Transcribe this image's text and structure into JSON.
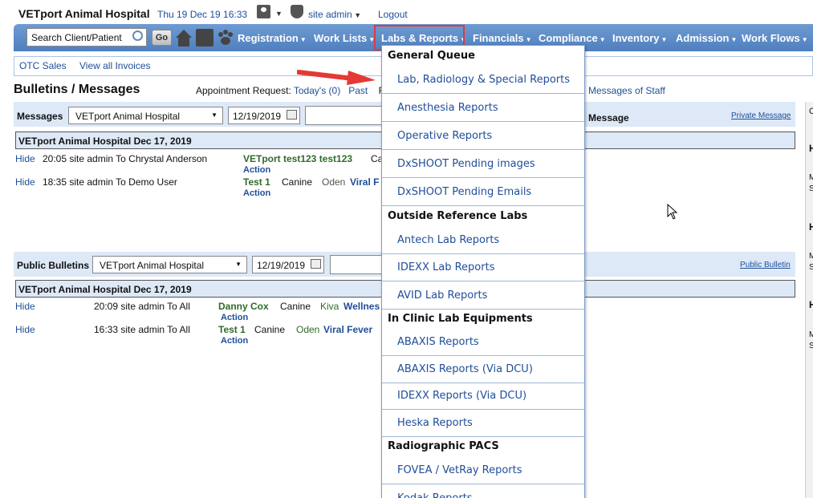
{
  "header": {
    "hospital": "VETport Animal Hospital",
    "datetime": "Thu 19 Dec 19 16:33",
    "user": "site admin",
    "logout": "Logout"
  },
  "nav": {
    "search_placeholder": "Search Client/Patient",
    "go": "Go",
    "items": [
      "Registration",
      "Work Lists",
      "Labs & Reports",
      "Financials",
      "Compliance",
      "Inventory",
      "Admission",
      "Work Flows"
    ]
  },
  "subnav": [
    "OTC Sales",
    "View all Invoices"
  ],
  "page": {
    "title": "Bulletins / Messages",
    "appt_label": "Appointment Request:",
    "appt_today": "Today's (0)",
    "appt_past": "Past",
    "appt_r": "R",
    "messages_of_staff": "Messages of Staff"
  },
  "messages": {
    "label": "Messages",
    "hospital_select": "VETport Animal Hospital",
    "date": "12/19/2019",
    "message_col": "Message",
    "private_link": "Private Message",
    "day_header": "VETport Animal Hospital  Dec 17, 2019",
    "rows": [
      {
        "hide": "Hide",
        "text": "20:05 site admin To Chrystal Anderson",
        "patient": "VETport test123 test123",
        "extra": "Ca",
        "action": "Action"
      },
      {
        "hide": "Hide",
        "text": "18:35 site admin To Demo User",
        "patient": "Test 1",
        "species": "Canine",
        "name": "Oden",
        "reason": "Viral F",
        "action": "Action"
      }
    ]
  },
  "bulletins": {
    "label": "Public Bulletins",
    "hospital_select": "VETport Animal Hospital",
    "date": "12/19/2019",
    "public_link": "Public Bulletin",
    "day_header": "VETport Animal Hospital  Dec 17, 2019",
    "rows": [
      {
        "hide": "Hide",
        "text": "20:09 site admin To All",
        "patient": "Danny Cox",
        "species": "Canine",
        "name": "Kiva",
        "reason": "Wellnes",
        "action": "Action"
      },
      {
        "hide": "Hide",
        "text": "16:33 site admin To All",
        "patient": "Test 1",
        "species": "Canine",
        "name": "Oden",
        "reason": "Viral Fever",
        "action": "Action"
      }
    ]
  },
  "right_panel": {
    "letters": [
      "C",
      "H",
      "M",
      "S",
      "H",
      "M",
      "S",
      "H",
      "M",
      "S"
    ]
  },
  "dropdown": {
    "general_queue": "General Queue",
    "general_items": [
      "Lab, Radiology & Special Reports",
      "Anesthesia Reports",
      "Operative Reports",
      "DxSHOOT Pending images",
      "DxSHOOT Pending Emails"
    ],
    "outside_labs": "Outside Reference Labs",
    "outside_items": [
      "Antech Lab Reports",
      "IDEXX Lab Reports",
      "AVID Lab Reports"
    ],
    "in_clinic": "In Clinic Lab Equipments",
    "in_clinic_items": [
      "ABAXIS Reports",
      "ABAXIS Reports (Via DCU)",
      "IDEXX Reports (Via DCU)",
      "Heska Reports"
    ],
    "pacs": "Radiographic PACS",
    "pacs_items": [
      "FOVEA / VetRay Reports",
      "Kodak Reports"
    ]
  },
  "colors": {
    "nav_bg": "#5a88c6",
    "link": "#1f4e99",
    "highlight": "#e03a3a"
  }
}
